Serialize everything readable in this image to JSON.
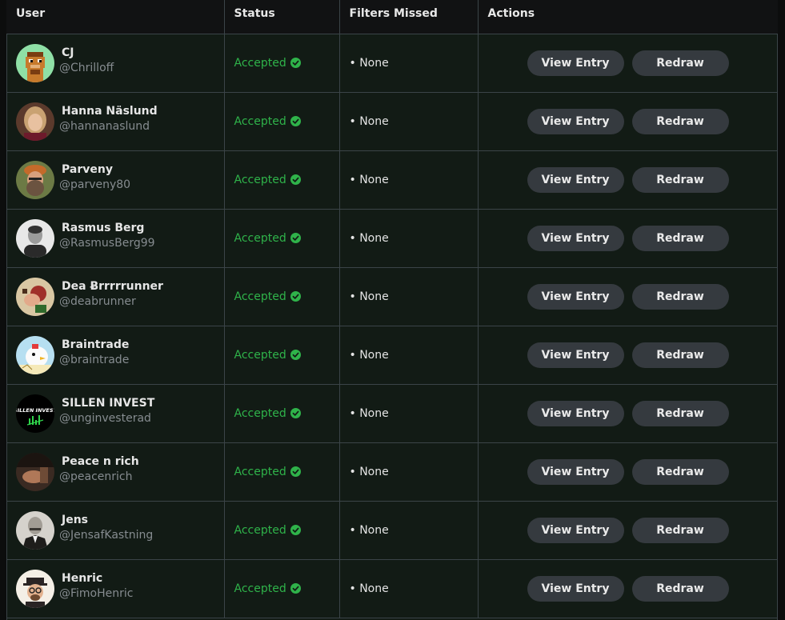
{
  "table": {
    "headers": {
      "user": "User",
      "status": "Status",
      "filters_missed": "Filters Missed",
      "actions": "Actions"
    },
    "rows": [
      {
        "name": "CJ",
        "handle": "@Chrilloff",
        "status": "Accepted",
        "filters": "• None",
        "view_label": "View Entry",
        "redraw_label": "Redraw",
        "avatar": "pixel-ape-avatar"
      },
      {
        "name": "Hanna Näslund",
        "handle": "@hannanaslund",
        "status": "Accepted",
        "filters": "• None",
        "view_label": "View Entry",
        "redraw_label": "Redraw",
        "avatar": "photo-avatar"
      },
      {
        "name": "Parveny",
        "handle": "@parveny80",
        "status": "Accepted",
        "filters": "• None",
        "view_label": "View Entry",
        "redraw_label": "Redraw",
        "avatar": "photo-avatar"
      },
      {
        "name": "Rasmus Berg",
        "handle": "@RasmusBerg99",
        "status": "Accepted",
        "filters": "• None",
        "view_label": "View Entry",
        "redraw_label": "Redraw",
        "avatar": "photo-avatar"
      },
      {
        "name": "Dea Ƀrrrrrunner",
        "handle": "@deabrunner",
        "status": "Accepted",
        "filters": "• None",
        "view_label": "View Entry",
        "redraw_label": "Redraw",
        "avatar": "illustration-avatar"
      },
      {
        "name": "Braintrade",
        "handle": "@braintrade",
        "status": "Accepted",
        "filters": "• None",
        "view_label": "View Entry",
        "redraw_label": "Redraw",
        "avatar": "cartoon-chicken-avatar"
      },
      {
        "name": "SILLEN INVEST",
        "handle": "@unginvesterad",
        "status": "Accepted",
        "filters": "• None",
        "view_label": "View Entry",
        "redraw_label": "Redraw",
        "avatar": "logo-avatar"
      },
      {
        "name": "Peace n rich",
        "handle": "@peacenrich",
        "status": "Accepted",
        "filters": "• None",
        "view_label": "View Entry",
        "redraw_label": "Redraw",
        "avatar": "photo-avatar"
      },
      {
        "name": "Jens",
        "handle": "@JensafKastning",
        "status": "Accepted",
        "filters": "• None",
        "view_label": "View Entry",
        "redraw_label": "Redraw",
        "avatar": "portrait-avatar"
      },
      {
        "name": "Henric",
        "handle": "@FimoHenric",
        "status": "Accepted",
        "filters": "• None",
        "view_label": "View Entry",
        "redraw_label": "Redraw",
        "avatar": "cartoon-avatar"
      }
    ]
  },
  "colors": {
    "status_accepted": "#2fb34a",
    "button_bg": "#353a3f",
    "row_bg": "#121b15",
    "header_bg": "#111213"
  },
  "avatar_texts": {
    "sillen_logo": "SILLEN INVEST"
  }
}
